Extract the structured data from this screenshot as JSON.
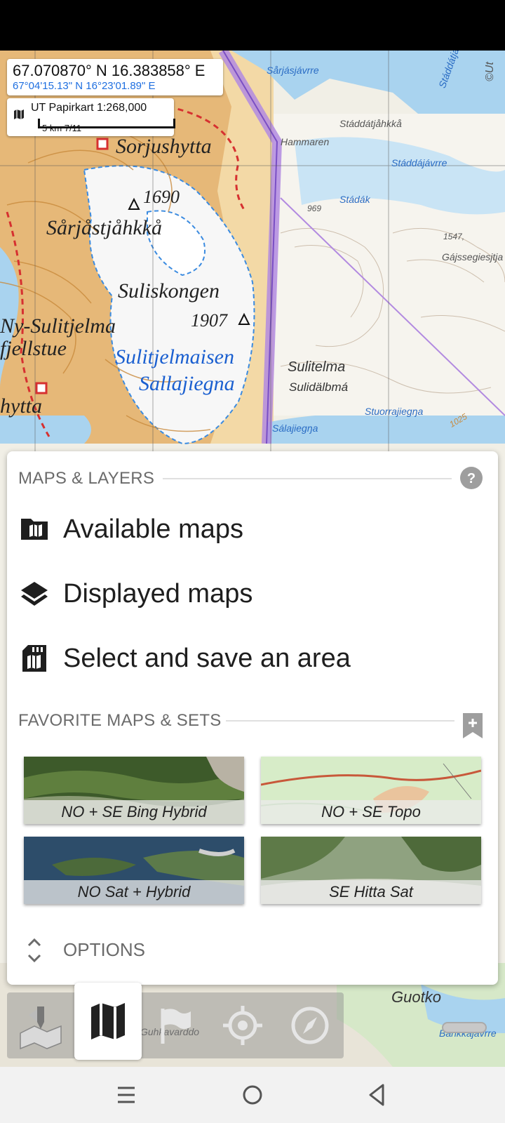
{
  "coordinates": {
    "decimal": "67.070870° N 16.383858° E",
    "dms": "67°04'15.13\" N 16°23'01.89\" E"
  },
  "scale": {
    "map_name": "UT Papirkart 1:268,000",
    "bar_label": "5 km  7/11"
  },
  "map_labels": {
    "copyright": "©Ut",
    "sorjushytta": "Sorjushytta",
    "peak_1690": "1690",
    "sarjastjahkka": "Sårjåstjåhkkå",
    "suliskongen": "Suliskongen",
    "peak_1907": "1907",
    "ny_sulitjelma": "Ny-Sulitjelma",
    "fjellstue": "fjellstue",
    "sulitjelmaisen": "Sulitjelmaisen",
    "sallajiegna": "Sallajiegna",
    "hytta": "hytta",
    "sarjasjavrre": "Sårjásjávrre",
    "staddatjahkka": "Stáddátjåhkkå",
    "staddatjahkka2": "Stáddátjåhkká",
    "hammaren": "Hammaren",
    "staddajavrre": "Stáddájávrre",
    "stadak": "Stádák",
    "spot_969": "969",
    "spot_1547": "1547,",
    "gajssegiesjtja": "Gájssegiesjtja",
    "sulitelma": "Sulitelma",
    "sulidalbma": "Sulidälbmá",
    "stuorrajiegna": "Stuorrajiegŋa",
    "salajiegna": "Sálajiegŋa",
    "spot_1025": "1025",
    "guotko": "Guotko",
    "batkkajavrre": "Báhkkájávrre",
    "guhkavarddo": "Guhkavarddo"
  },
  "sheet": {
    "maps_layers_title": "MAPS & LAYERS",
    "menu": [
      {
        "label": "Available maps",
        "icon": "map-folder-icon"
      },
      {
        "label": "Displayed maps",
        "icon": "layers-icon"
      },
      {
        "label": "Select and save an area",
        "icon": "sd-card-map-icon"
      }
    ],
    "favorites_title": "FAVORITE MAPS & SETS",
    "favorites": [
      {
        "label": "NO + SE Bing Hybrid"
      },
      {
        "label": "NO + SE Topo"
      },
      {
        "label": "NO Sat + Hybrid"
      },
      {
        "label": "SE Hitta Sat"
      }
    ],
    "options_label": "OPTIONS"
  },
  "toolbar": {
    "items": [
      {
        "icon": "map-pin-icon"
      },
      {
        "icon": "map-icon",
        "active": true
      },
      {
        "icon": "flag-icon"
      },
      {
        "icon": "crosshair-icon"
      },
      {
        "icon": "compass-icon"
      }
    ]
  },
  "colors": {
    "map_water": "#a9d3ef",
    "map_land": "#f1efe6",
    "map_contour": "#c98a3c",
    "section_gray": "#6b6b6b",
    "coord_blue": "#1f6fe0"
  }
}
